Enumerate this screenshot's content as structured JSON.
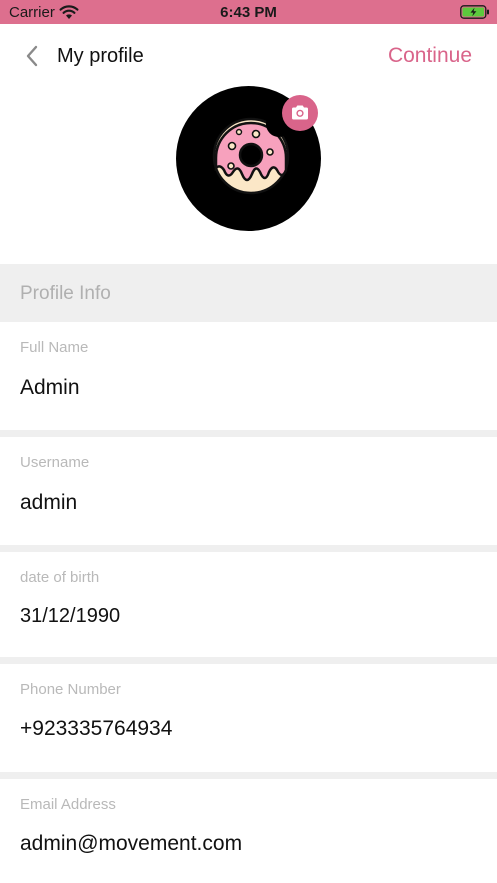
{
  "status_bar": {
    "carrier": "Carrier",
    "time": "6:43 PM",
    "icons": [
      "wifi-icon",
      "battery-charging-icon"
    ]
  },
  "nav": {
    "title": "My profile",
    "continue_label": "Continue",
    "back_icon": "chevron-left-icon"
  },
  "avatar": {
    "image": "donut-avatar",
    "edit_icon": "camera-icon"
  },
  "section": {
    "title": "Profile Info"
  },
  "fields": [
    {
      "label": "Full Name",
      "value": "Admin"
    },
    {
      "label": "Username",
      "value": "admin"
    },
    {
      "label": "date of birth",
      "value": "31/12/1990"
    },
    {
      "label": "Phone Number",
      "value": "+923335764934"
    },
    {
      "label": "Email Address",
      "value": "admin@movement.com"
    }
  ],
  "colors": {
    "accent": "#d9648a",
    "status_bar": "#dd6f8e",
    "section_bg": "#efefef",
    "label_text": "#b9b9b9",
    "battery_charge": "#5cc93d"
  }
}
